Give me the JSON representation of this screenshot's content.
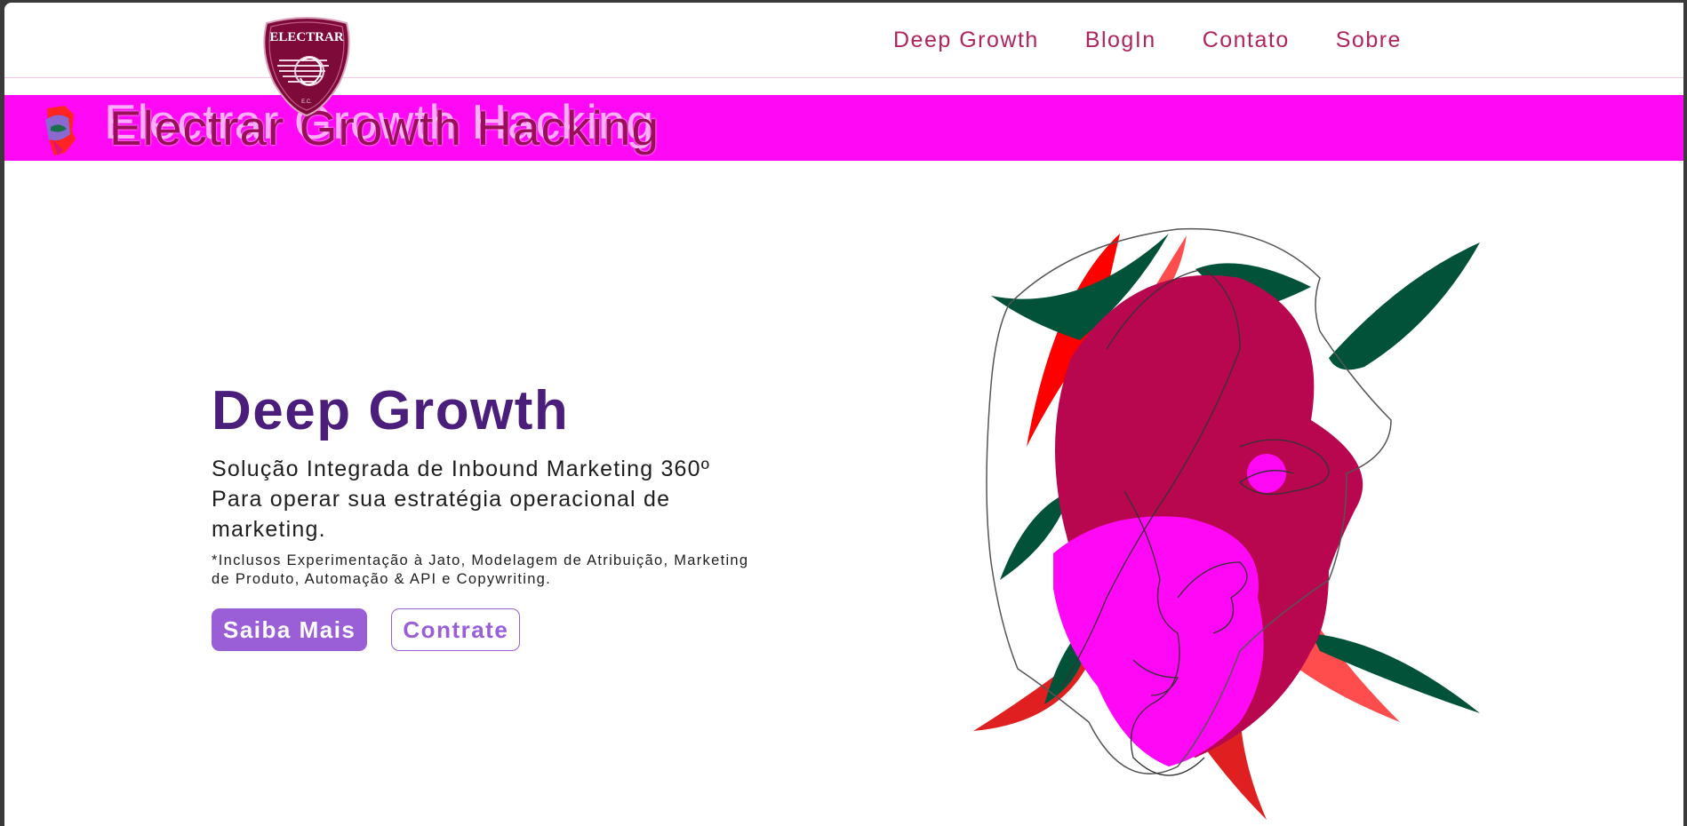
{
  "header": {
    "logo_text": "ELECTRAR",
    "nav": [
      {
        "label": "Deep Growth"
      },
      {
        "label": "BlogIn"
      },
      {
        "label": "Contato"
      },
      {
        "label": "Sobre"
      }
    ]
  },
  "banner": {
    "title": "Electrar Growth Hacking",
    "color": "#ff08f6"
  },
  "hero": {
    "title": "Deep Growth",
    "subtitle": "Solução Integrada de Inbound Marketing 360º Para operar sua estratégia operacional de marketing.",
    "note": "*Inclusos Experimentação à Jato, Modelagem de Atribuição, Marketing de Produto, Automação & API e Copywriting.",
    "primary_button": "Saiba Mais",
    "secondary_button": "Contrate"
  },
  "colors": {
    "nav_link": "#b0245e",
    "title": "#4a1e7a",
    "button": "#9a5fd6",
    "art_magenta": "#ff08f6",
    "art_crimson": "#b8074f",
    "art_green": "#02523a",
    "art_red": "#ff1a1a"
  },
  "icons": [
    "logo-shield-icon",
    "abstract-face-icon",
    "abstract-face-illustration"
  ]
}
